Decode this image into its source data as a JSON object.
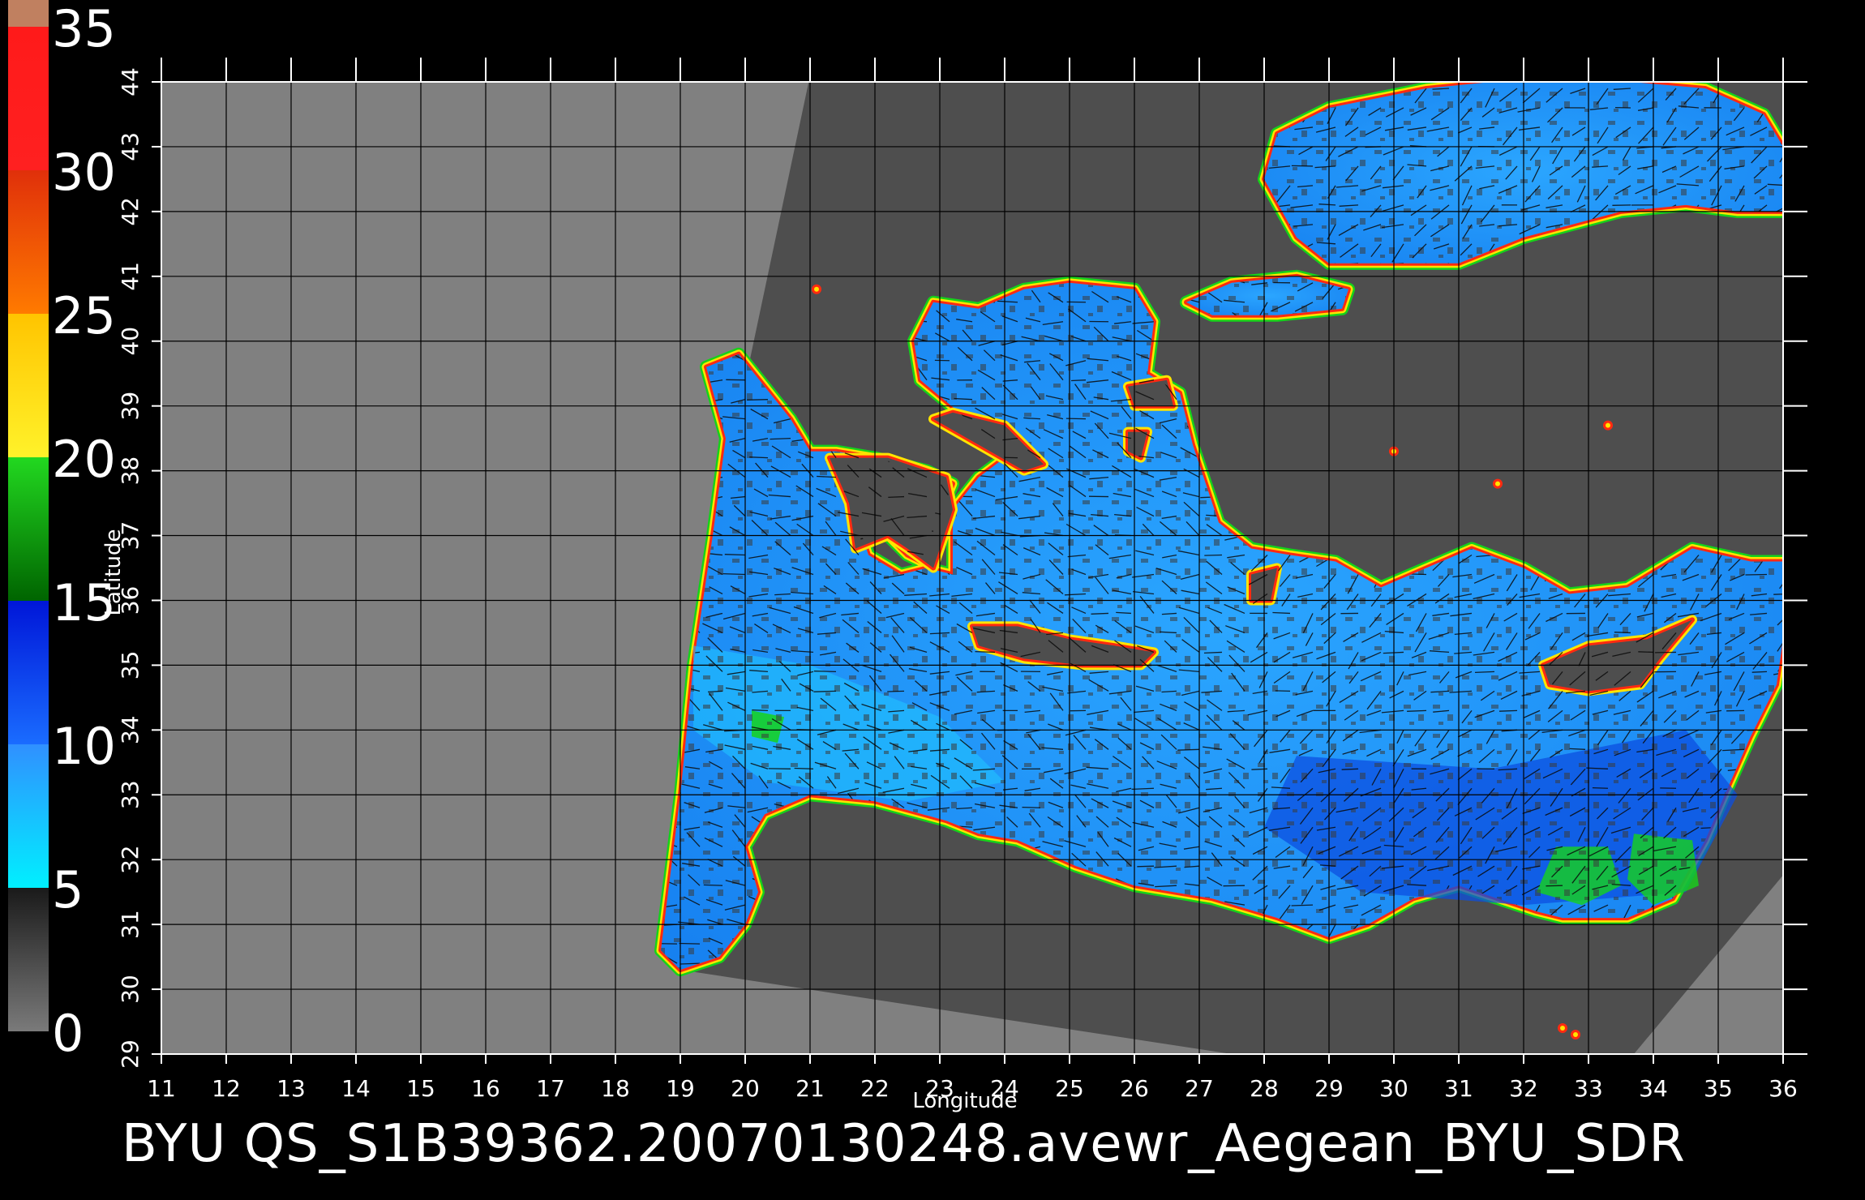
{
  "colorbar": {
    "labels": [
      "0",
      "5",
      "10",
      "15",
      "20",
      "25",
      "30",
      "35"
    ],
    "segments": [
      {
        "from": 0,
        "to": 5,
        "colors": [
          "#7a7a7a",
          "#1a1a1a"
        ]
      },
      {
        "from": 5,
        "to": 10,
        "colors": [
          "#00f0ff",
          "#3090ff"
        ]
      },
      {
        "from": 10,
        "to": 15,
        "colors": [
          "#1a6cff",
          "#0016d8"
        ]
      },
      {
        "from": 15,
        "to": 20,
        "colors": [
          "#006400",
          "#22d820"
        ]
      },
      {
        "from": 20,
        "to": 25,
        "colors": [
          "#fff22a",
          "#ffc400"
        ]
      },
      {
        "from": 25,
        "to": 30,
        "colors": [
          "#ff7a00",
          "#e0300a"
        ]
      },
      {
        "from": 30,
        "to": 35,
        "colors": [
          "#ff2020",
          "#ff1a1a"
        ]
      },
      {
        "from": 35,
        "to": 36,
        "colors": [
          "#c08060",
          "#c08060"
        ]
      }
    ]
  },
  "map": {
    "lon_range": [
      11,
      36
    ],
    "lat_range": [
      29,
      44
    ],
    "lon_ticks": [
      "11",
      "12",
      "13",
      "14",
      "15",
      "16",
      "17",
      "18",
      "19",
      "20",
      "21",
      "22",
      "23",
      "24",
      "25",
      "26",
      "27",
      "28",
      "29",
      "30",
      "31",
      "32",
      "33",
      "34",
      "35",
      "36"
    ],
    "lat_ticks": [
      "29",
      "30",
      "31",
      "32",
      "33",
      "34",
      "35",
      "36",
      "37",
      "38",
      "39",
      "40",
      "41",
      "42",
      "43",
      "44"
    ],
    "x_axis_title": "Longitude",
    "y_axis_title": "Latitude",
    "colors": {
      "outside_swath": "#808080",
      "land_in_swath": "#4e4e4e",
      "sea_main": "#1f9bff",
      "sea_deep": "#0c4fe0",
      "sea_light": "#21c9ff",
      "coast_red": "#ff2a10",
      "coast_yellow": "#ffe400",
      "coast_green": "#16d21a",
      "grid": "#000000"
    }
  },
  "title": "BYU  QS_S1B39362.20070130248.avewr_Aegean_BYU_SDR"
}
